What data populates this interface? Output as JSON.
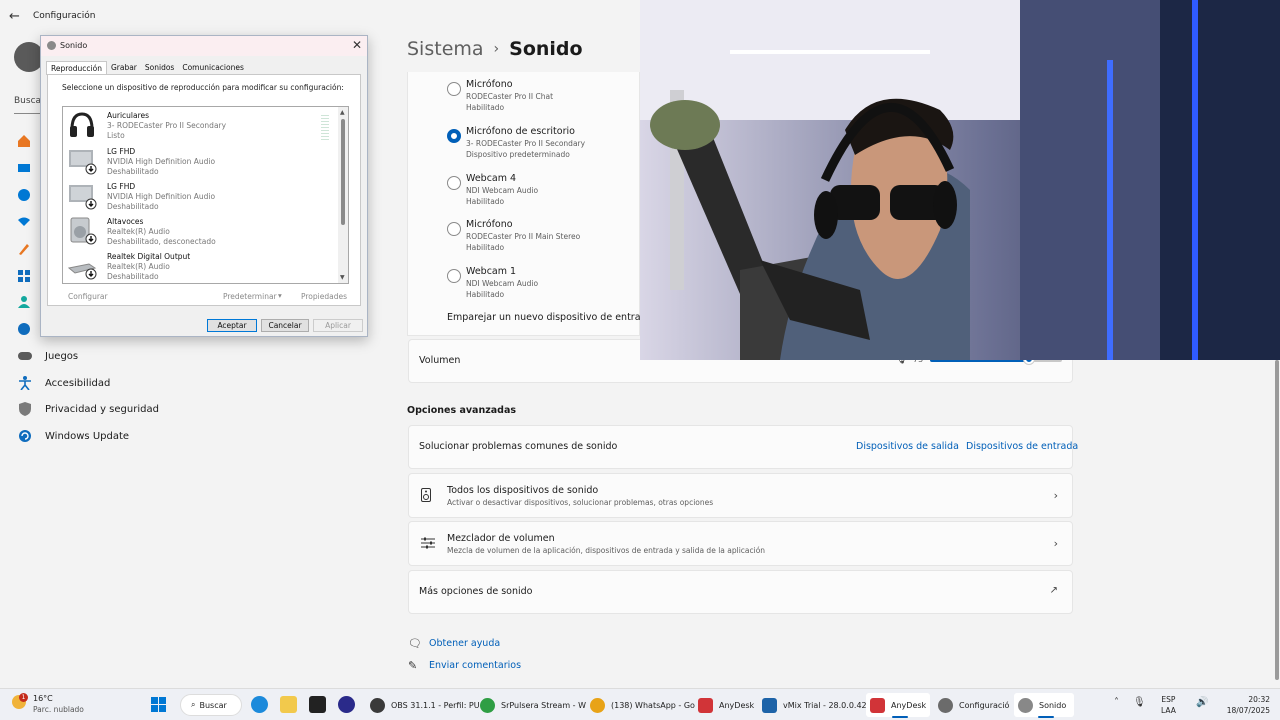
{
  "window": {
    "title": "Configuración"
  },
  "nav": {
    "search_placeholder": "Busca",
    "items": [
      {
        "label": "Juegos",
        "icon": "gamepad-icon"
      },
      {
        "label": "Accesibilidad",
        "icon": "accessibility-icon"
      },
      {
        "label": "Privacidad y seguridad",
        "icon": "shield-icon"
      },
      {
        "label": "Windows Update",
        "icon": "update-icon"
      }
    ]
  },
  "breadcrumb": {
    "parent": "Sistema",
    "separator": "›",
    "current": "Sonido"
  },
  "input_devices": [
    {
      "name": "Micrófono",
      "line1": "RODECaster Pro II Chat",
      "line2": "Habilitado",
      "selected": false
    },
    {
      "name": "Micrófono de escritorio",
      "line1": "3- RODECaster Pro II Secondary",
      "line2": "Dispositivo predeterminado",
      "selected": true
    },
    {
      "name": "Webcam 4",
      "line1": "NDI Webcam Audio",
      "line2": "Habilitado",
      "selected": false
    },
    {
      "name": "Micrófono",
      "line1": "RODECaster Pro II Main Stereo",
      "line2": "Habilitado",
      "selected": false
    },
    {
      "name": "Webcam 1",
      "line1": "NDI Webcam Audio",
      "line2": "Habilitado",
      "selected": false
    }
  ],
  "pair_new_input": "Emparejar un nuevo dispositivo de entrada",
  "volume": {
    "label": "Volumen",
    "value_text": "75",
    "level": 0.75
  },
  "advanced": {
    "title": "Opciones avanzadas",
    "troubleshoot": {
      "label": "Solucionar problemas comunes de sonido",
      "output_link": "Dispositivos de salida",
      "input_link": "Dispositivos de entrada"
    },
    "all_devices": {
      "label": "Todos los dispositivos de sonido",
      "sub": "Activar o desactivar dispositivos, solucionar problemas, otras opciones"
    },
    "mixer": {
      "label": "Mezclador de volumen",
      "sub": "Mezcla de volumen de la aplicación, dispositivos de entrada y salida de la aplicación"
    },
    "more": {
      "label": "Más opciones de sonido"
    }
  },
  "help": {
    "get_help": "Obtener ayuda",
    "feedback": "Enviar comentarios"
  },
  "dialog": {
    "title": "Sonido",
    "tabs": [
      "Reproducción",
      "Grabar",
      "Sonidos",
      "Comunicaciones"
    ],
    "instruction": "Seleccione un dispositivo de reproducción para modificar su configuración:",
    "devices": [
      {
        "name": "Auriculares",
        "line1": "3- RODECaster Pro II Secondary",
        "line2": "Listo",
        "icon": "headphones-icon"
      },
      {
        "name": "LG FHD",
        "line1": "NVIDIA High Definition Audio",
        "line2": "Deshabilitado",
        "icon": "monitor-icon"
      },
      {
        "name": "LG FHD",
        "line1": "NVIDIA High Definition Audio",
        "line2": "Deshabilitado",
        "icon": "monitor-icon"
      },
      {
        "name": "Altavoces",
        "line1": "Realtek(R) Audio",
        "line2": "Deshabilitado, desconectado",
        "icon": "speaker-icon"
      },
      {
        "name": "Realtek Digital Output",
        "line1": "Realtek(R) Audio",
        "line2": "Deshabilitado",
        "icon": "digital-output-icon"
      }
    ],
    "configure": "Configurar",
    "set_default": "Predeterminar",
    "properties": "Propiedades",
    "ok": "Aceptar",
    "cancel": "Cancelar",
    "apply": "Aplicar"
  },
  "taskbar": {
    "weather": {
      "badge": "1",
      "temp": "16°C",
      "condition": "Parc. nublado"
    },
    "search": "Buscar",
    "apps": [
      {
        "label": "OBS 31.1.1 - Perfil: PU",
        "color": "#3a3a3a"
      },
      {
        "label": "SrPulsera Stream - W",
        "color": "#2f9e44"
      },
      {
        "label": "(138) WhatsApp - Go",
        "color": "#e8a317"
      },
      {
        "label": "AnyDesk",
        "color": "#d13438"
      },
      {
        "label": "vMix Trial - 28.0.0.42",
        "color": "#1d63a8"
      },
      {
        "label": "AnyDesk",
        "color": "#d13438"
      },
      {
        "label": "Configuració",
        "color": "#6b6b6b"
      },
      {
        "label": "Sonido",
        "color": "#888888"
      }
    ],
    "lang_top": "ESP",
    "lang_bottom": "LAA",
    "time": "20:32",
    "date": "18/07/2025"
  }
}
